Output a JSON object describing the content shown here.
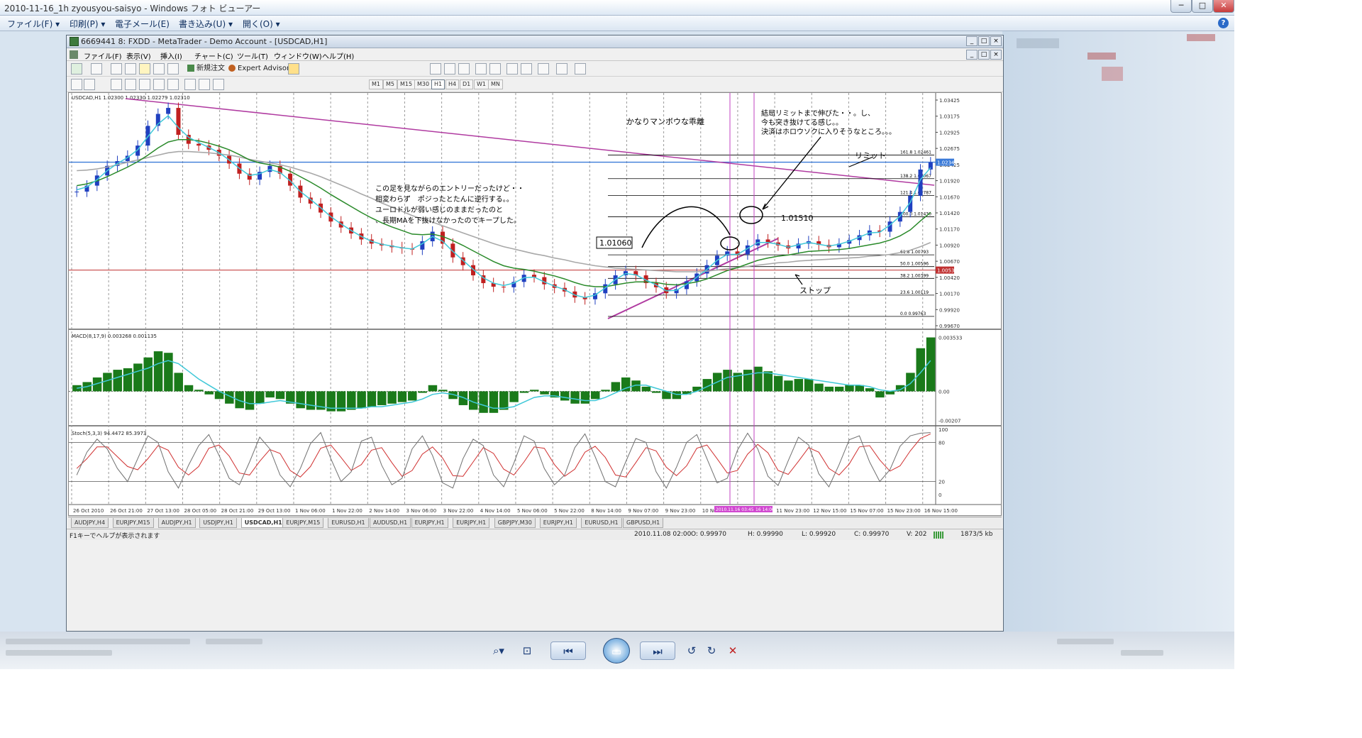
{
  "viewer": {
    "title": "2010-11-16_1h zyousyou-saisyo - Windows フォト ビューアー",
    "menu": [
      "ファイル(F) ▾",
      "印刷(P) ▾",
      "電子メール(E)",
      "書き込み(U) ▾",
      "開く(O) ▾"
    ],
    "controls": {
      "zoom": "zoom-icon",
      "fit": "fit-icon",
      "previous": "previous-icon",
      "slideshow": "slideshow-icon",
      "next": "next-icon",
      "rotate_left": "rotate-ccw-icon",
      "rotate_right": "rotate-cw-icon",
      "delete": "delete-icon"
    }
  },
  "mt4": {
    "title": "6669441 8: FXDD - MetaTrader - Demo Account - [USDCAD,H1]",
    "menu": [
      "ファイル(F)",
      "表示(V)",
      "挿入(I)",
      "チャート(C)",
      "ツール(T)",
      "ウィンドウ(W)",
      "ヘルプ(H)"
    ],
    "toolbar": {
      "new_order": "新規注文",
      "expert_advisors": "Expert Advisors"
    },
    "timeframes": [
      "M1",
      "M5",
      "M15",
      "M30",
      "H1",
      "H4",
      "D1",
      "W1",
      "MN"
    ],
    "selected_timeframe": "H1",
    "symbol_tabs": [
      "AUDJPY,H4",
      "EURJPY,M15",
      "AUDJPY,H1",
      "USDJPY,H1",
      "USDCAD,H1",
      "EURJPY,M15",
      "EURUSD,H1",
      "AUDUSD,H1",
      "EURJPY,H1",
      "EURJPY,H1",
      "GBPJPY,M30",
      "EURJPY,H1",
      "EURUSD,H1",
      "GBPUSD,H1"
    ],
    "selected_symbol_tab": "USDCAD,H1",
    "status": {
      "help": "F1キーでヘルプが表示されます",
      "time": "2010.11.08 02:00",
      "open": "O: 0.99970",
      "high": "H: 0.99990",
      "low": "L: 0.99920",
      "close": "C: 0.99970",
      "volume": "V: 202",
      "traffic": "1873/5 kb"
    }
  },
  "chart_data": {
    "type": "line",
    "symbol_header": "USDCAD,H1  1.02300 1.02330 1.02279 1.02310",
    "macd_header": "MACD(8,17,9) 0.003268 0.001135",
    "stoch_header": "Stoch(5,3,3) 94.4472 85.3973",
    "x_ticks": [
      "26 Oct 2010",
      "26 Oct 21:00",
      "27 Oct 13:00",
      "28 Oct 05:00",
      "28 Oct 21:00",
      "29 Oct 13:00",
      "1 Nov 06:00",
      "1 Nov 22:00",
      "2 Nov 14:00",
      "3 Nov 06:00",
      "3 Nov 22:00",
      "4 Nov 14:00",
      "5 Nov 06:00",
      "5 Nov 22:00",
      "8 Nov 14:00",
      "9 Nov 07:00",
      "9 Nov 23:00",
      "10 Nov 15:00",
      "11 Nov 07:00",
      "11 Nov 23:00",
      "12 Nov 15:00",
      "15 Nov 07:00",
      "15 Nov 23:00",
      "16 Nov 15:00"
    ],
    "y_ticks": [
      "1.03425",
      "1.03175",
      "1.02925",
      "1.02675",
      "1.02425",
      "1.01920",
      "1.01670",
      "1.01420",
      "1.01170",
      "1.00920",
      "1.00670",
      "1.00420",
      "1.00170",
      "0.99920",
      "0.99670"
    ],
    "price_current": "1.02342",
    "price_stop": "1.00538",
    "macd_ticks": [
      "0.003533",
      "0.00",
      "-0.00207"
    ],
    "stoch_ticks": [
      "100",
      "80",
      "20",
      "0"
    ],
    "price_close": [
      1.0185,
      1.0195,
      1.0212,
      1.0228,
      1.0236,
      1.0245,
      1.0262,
      1.0295,
      1.0315,
      1.0325,
      1.028,
      1.0265,
      1.0262,
      1.0255,
      1.0245,
      1.0232,
      1.0215,
      1.0205,
      1.0218,
      1.0228,
      1.0215,
      1.0195,
      1.0175,
      1.0165,
      1.015,
      1.0135,
      1.0125,
      1.0115,
      1.0105,
      1.0098,
      1.0095,
      1.0092,
      1.009,
      1.0088,
      1.0102,
      1.0118,
      1.0098,
      1.0075,
      1.0062,
      1.0045,
      1.0032,
      1.0026,
      1.0025,
      1.0034,
      1.0046,
      1.0042,
      1.003,
      1.0024,
      1.0018,
      1.0008,
      1.0005,
      1.0015,
      1.003,
      1.0045,
      1.0052,
      1.0045,
      1.0032,
      1.0025,
      1.0015,
      1.0022,
      1.0035,
      1.0048,
      1.0062,
      1.0078,
      1.0085,
      1.008,
      1.0095,
      1.0105,
      1.01,
      1.0095,
      1.009,
      1.0098,
      1.0102,
      1.0096,
      1.0092,
      1.0098,
      1.0104,
      1.0112,
      1.012,
      1.0118,
      1.0135,
      1.0151,
      1.0178,
      1.0222,
      1.0234
    ],
    "ma_fast": [
      1.0188,
      1.0193,
      1.0205,
      1.022,
      1.0232,
      1.0242,
      1.0255,
      1.0277,
      1.0298,
      1.0312,
      1.0292,
      1.0276,
      1.0267,
      1.0259,
      1.025,
      1.0238,
      1.0224,
      1.0212,
      1.0215,
      1.0222,
      1.0217,
      1.0203,
      1.0185,
      1.0172,
      1.0158,
      1.0143,
      1.0131,
      1.012,
      1.011,
      1.0102,
      1.0097,
      1.0094,
      1.0091,
      1.0089,
      1.0098,
      1.011,
      1.0102,
      1.0085,
      1.007,
      1.0055,
      1.0041,
      1.0032,
      1.0028,
      1.0032,
      1.0041,
      1.0042,
      1.0034,
      1.0027,
      1.0021,
      1.0012,
      1.0008,
      1.0012,
      1.0024,
      1.0038,
      1.0048,
      1.0046,
      1.0037,
      1.0029,
      1.0019,
      1.002,
      1.003,
      1.0042,
      1.0055,
      1.007,
      1.008,
      1.008,
      1.009,
      1.01,
      1.01,
      1.0097,
      1.0092,
      1.0096,
      1.01,
      1.0097,
      1.0094,
      1.0097,
      1.0102,
      1.0109,
      1.0116,
      1.0117,
      1.0129,
      1.0144,
      1.0167,
      1.0205,
      1.0225
    ],
    "ma_mid": [
      1.0195,
      1.0198,
      1.0203,
      1.021,
      1.0218,
      1.0226,
      1.0235,
      1.0246,
      1.0258,
      1.0268,
      1.0272,
      1.0272,
      1.027,
      1.0266,
      1.0261,
      1.0255,
      1.0247,
      1.0238,
      1.0233,
      1.023,
      1.0226,
      1.0219,
      1.021,
      1.0201,
      1.0191,
      1.018,
      1.017,
      1.016,
      1.015,
      1.0141,
      1.0133,
      1.0126,
      1.012,
      1.0114,
      1.0113,
      1.0114,
      1.011,
      1.0103,
      1.0095,
      1.0086,
      1.0077,
      1.0068,
      1.0061,
      1.0057,
      1.0055,
      1.0052,
      1.0048,
      1.0044,
      1.0039,
      1.0033,
      1.0028,
      1.0026,
      1.0026,
      1.0029,
      1.0032,
      1.0034,
      1.0034,
      1.0033,
      1.003,
      1.0029,
      1.0031,
      1.0034,
      1.0039,
      1.0046,
      1.0053,
      1.0058,
      1.0064,
      1.007,
      1.0074,
      1.0077,
      1.0079,
      1.0082,
      1.0085,
      1.0086,
      1.0087,
      1.0088,
      1.009,
      1.0093,
      1.0096,
      1.0099,
      1.0104,
      1.0111,
      1.0121,
      1.0136,
      1.015
    ],
    "ma_slow": [
      1.022,
      1.0221,
      1.0223,
      1.0226,
      1.023,
      1.0234,
      1.0238,
      1.0242,
      1.0246,
      1.025,
      1.0252,
      1.0252,
      1.0251,
      1.025,
      1.0248,
      1.0246,
      1.0243,
      1.0239,
      1.0236,
      1.0233,
      1.023,
      1.0226,
      1.0221,
      1.0216,
      1.021,
      1.0203,
      1.0196,
      1.0189,
      1.0181,
      1.0174,
      1.0166,
      1.0159,
      1.0152,
      1.0145,
      1.0139,
      1.0134,
      1.0128,
      1.0122,
      1.0116,
      1.011,
      1.0104,
      1.0098,
      1.0093,
      1.0089,
      1.0085,
      1.0081,
      1.0078,
      1.0074,
      1.0071,
      1.0067,
      1.0064,
      1.0061,
      1.0059,
      1.0057,
      1.0056,
      1.0055,
      1.0054,
      1.0053,
      1.0052,
      1.0051,
      1.0051,
      1.0051,
      1.0052,
      1.0054,
      1.0056,
      1.0058,
      1.006,
      1.0062,
      1.0064,
      1.0066,
      1.0067,
      1.0069,
      1.007,
      1.0071,
      1.0072,
      1.0073,
      1.0074,
      1.0075,
      1.0077,
      1.0078,
      1.008,
      1.0083,
      1.0087,
      1.0093,
      1.01
    ],
    "macd_hist": [
      0.0004,
      0.0006,
      0.0009,
      0.0012,
      0.0014,
      0.0015,
      0.0018,
      0.0022,
      0.0026,
      0.0025,
      0.0012,
      0.0004,
      0.0001,
      -0.0002,
      -0.0005,
      -0.0008,
      -0.0011,
      -0.0012,
      -0.0008,
      -0.0004,
      -0.0005,
      -0.0008,
      -0.0011,
      -0.0012,
      -0.0012,
      -0.0013,
      -0.0013,
      -0.0012,
      -0.0011,
      -0.001,
      -0.0009,
      -0.0008,
      -0.0007,
      -0.0006,
      -0.0001,
      0.0004,
      0.0001,
      -0.0005,
      -0.0009,
      -0.0012,
      -0.0014,
      -0.0014,
      -0.0012,
      -0.0007,
      -0.0001,
      0.0001,
      -0.0002,
      -0.0004,
      -0.0006,
      -0.0008,
      -0.0008,
      -0.0005,
      0.0001,
      0.0006,
      0.0009,
      0.0007,
      0.0003,
      -0.0001,
      -0.0005,
      -0.0005,
      -0.0002,
      0.0003,
      0.0008,
      0.0012,
      0.0014,
      0.0012,
      0.0014,
      0.0016,
      0.0013,
      0.001,
      0.0007,
      0.0008,
      0.0008,
      0.0005,
      0.0003,
      0.0003,
      0.0004,
      0.0004,
      0.0002,
      -0.0004,
      -0.0002,
      0.0004,
      0.0012,
      0.0028,
      0.0035
    ],
    "macd_signal": [
      0.0002,
      0.0003,
      0.0005,
      0.0007,
      0.0009,
      0.0011,
      0.0013,
      0.0015,
      0.0018,
      0.002,
      0.0018,
      0.0013,
      0.0008,
      0.0004,
      0.0,
      -0.0003,
      -0.0006,
      -0.0008,
      -0.0008,
      -0.0007,
      -0.0006,
      -0.0007,
      -0.0008,
      -0.0009,
      -0.001,
      -0.0011,
      -0.0011,
      -0.0011,
      -0.0011,
      -0.001,
      -0.001,
      -0.0009,
      -0.0008,
      -0.0007,
      -0.0005,
      -0.0002,
      -0.0001,
      -0.0002,
      -0.0004,
      -0.0007,
      -0.0009,
      -0.0011,
      -0.0011,
      -0.001,
      -0.0007,
      -0.0004,
      -0.0003,
      -0.0003,
      -0.0004,
      -0.0005,
      -0.0006,
      -0.0006,
      -0.0004,
      -0.0001,
      0.0002,
      0.0004,
      0.0004,
      0.0002,
      0.0,
      -0.0002,
      -0.0002,
      0.0,
      0.0003,
      0.0006,
      0.0009,
      0.001,
      0.0011,
      0.0012,
      0.0012,
      0.0011,
      0.001,
      0.0009,
      0.0008,
      0.0007,
      0.0006,
      0.0005,
      0.0004,
      0.0004,
      0.0003,
      0.0001,
      0.0,
      0.0001,
      0.0005,
      0.0012,
      0.002
    ],
    "stoch_k": [
      30,
      65,
      85,
      70,
      40,
      20,
      55,
      90,
      80,
      35,
      10,
      45,
      75,
      92,
      60,
      25,
      15,
      50,
      88,
      70,
      30,
      12,
      40,
      78,
      95,
      55,
      20,
      35,
      82,
      88,
      45,
      15,
      25,
      70,
      90,
      60,
      18,
      10,
      55,
      85,
      75,
      30,
      12,
      48,
      90,
      82,
      40,
      15,
      30,
      72,
      93,
      58,
      20,
      12,
      50,
      86,
      80,
      35,
      10,
      42,
      80,
      92,
      55,
      18,
      25,
      68,
      94,
      70,
      28,
      14,
      52,
      88,
      76,
      32,
      12,
      46,
      84,
      90,
      50,
      20,
      38,
      74,
      90,
      94,
      95
    ],
    "stoch_d": [
      40,
      55,
      73,
      73,
      58,
      43,
      38,
      55,
      75,
      68,
      42,
      30,
      43,
      71,
      76,
      59,
      33,
      30,
      51,
      69,
      63,
      37,
      27,
      43,
      71,
      76,
      57,
      37,
      46,
      68,
      72,
      49,
      28,
      37,
      62,
      73,
      56,
      29,
      28,
      50,
      72,
      63,
      39,
      30,
      50,
      73,
      71,
      46,
      28,
      39,
      65,
      74,
      57,
      30,
      27,
      49,
      72,
      67,
      42,
      29,
      44,
      71,
      76,
      55,
      33,
      37,
      62,
      77,
      64,
      37,
      31,
      51,
      72,
      65,
      40,
      30,
      47,
      73,
      75,
      53,
      36,
      44,
      67,
      86,
      93
    ]
  },
  "annotations": {
    "memo_title": "かなりマンボウな乖離",
    "memo_entry": [
      "この足を見ながらのエントリーだったけど・・",
      "相変わらず　ポジったとたんに逆行する。。",
      "ユーロドルが弱い感じのままだったのと",
      "、長期MAを下抜けなかったのでキープした。"
    ],
    "memo_limit": [
      "結局リミットまで伸びた・・。し、",
      "今も突き抜けてる感じ。。",
      "決済はホロウソクに入りそうなところ。。。"
    ],
    "label_limit": "リミット",
    "label_stop": "ストップ",
    "price_entry": "1.01060",
    "price_exit": "1.01510",
    "fib_levels": [
      "161.8   1.02461",
      "138.2   1.02067",
      "121.4   1.01787",
      "100.0   1.01430",
      "61.8   1.00793",
      "50.0   1.00596",
      "38.2   1.00399",
      "23.6   1.00119",
      "0.0   0.99763"
    ],
    "date_marker_a": "2010.11.16 03:45",
    "date_marker_b": "16 14:00"
  }
}
